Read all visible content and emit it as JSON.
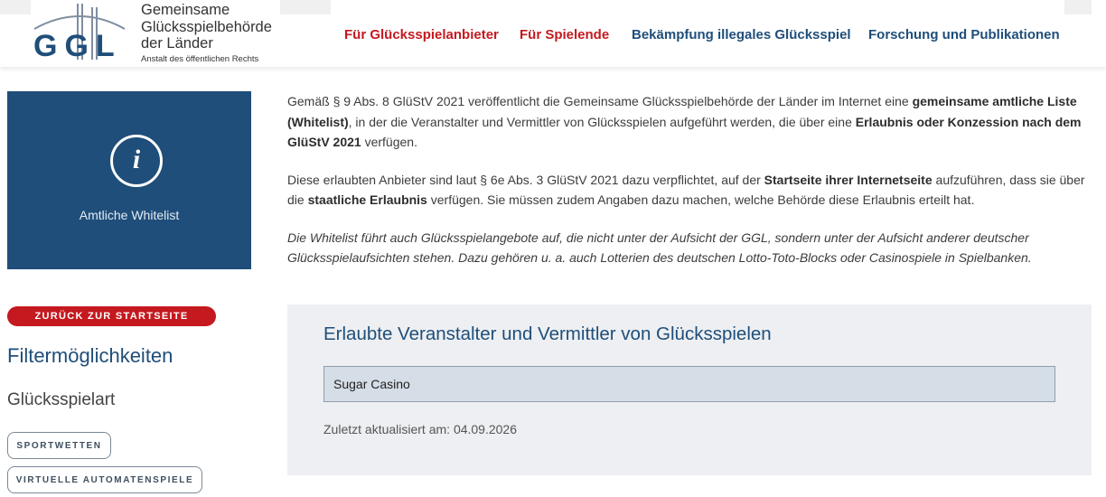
{
  "header": {
    "logo": {
      "letters": "GGL",
      "line1": "Gemeinsame",
      "line2": "Glücksspielbehörde",
      "line3": "der Länder",
      "sub": "Anstalt des öffentlichen Rechts"
    },
    "nav": [
      {
        "label": "Für Glücksspielanbieter"
      },
      {
        "label": "Für Spielende"
      },
      {
        "label": "Bekämpfung illegales Glücksspiel"
      },
      {
        "label": "Forschung und Publikationen"
      }
    ]
  },
  "sidebar": {
    "info_tile_label": "Amtliche Whitelist",
    "info_icon": "info-circle-icon",
    "back_button": "ZURÜCK ZUR STARTSEITE",
    "filter_title": "Filtermöglichkeiten",
    "filter_category": "Glücksspielart",
    "chips": [
      "SPORTWETTEN",
      "VIRTUELLE AUTOMATENSPIELE"
    ]
  },
  "intro": {
    "p1": [
      {
        "t": "Gemäß § 9 Abs. 8 GlüStV 2021 veröffentlicht die Gemeinsame Glücksspielbehörde der Länder im Internet eine ",
        "b": false
      },
      {
        "t": "gemeinsame amtliche Liste (Whitelist)",
        "b": true
      },
      {
        "t": ", in der die Veranstalter und Vermittler von Glücksspielen aufgeführt werden, die über eine ",
        "b": false
      },
      {
        "t": "Erlaubnis oder Konzession nach dem GlüStV 2021",
        "b": true
      },
      {
        "t": " verfügen.",
        "b": false
      }
    ],
    "p2": [
      {
        "t": "Diese erlaubten Anbieter sind laut § 6e Abs. 3 GlüStV 2021 dazu verpflichtet, auf der ",
        "b": false
      },
      {
        "t": "Startseite ihrer Internetseite",
        "b": true
      },
      {
        "t": " aufzuführen, dass sie über die ",
        "b": false
      },
      {
        "t": "staatliche Erlaubnis",
        "b": true
      },
      {
        "t": " verfügen. Sie müssen zudem Angaben dazu machen, welche Behörde diese Erlaubnis erteilt hat.",
        "b": false
      }
    ],
    "p3": "Die Whitelist führt auch Glücksspielangebote auf, die nicht unter der Aufsicht der GGL, sondern unter der Aufsicht anderer deutscher Glücksspielaufsichten stehen. Dazu gehören u. a. auch Lotterien des deutschen Lotto-Toto-Blocks oder Casinospiele in Spielbanken."
  },
  "search": {
    "title": "Erlaubte Veranstalter und Vermittler von Glücksspielen",
    "value": "Sugar Casino",
    "updated": "Zuletzt aktualisiert am: 04.09.2026"
  },
  "colors": {
    "brand_blue": "#1f4e7a",
    "accent_red": "#c4191f",
    "panel_bg": "#edeff2",
    "input_bg": "#d5dde6"
  }
}
